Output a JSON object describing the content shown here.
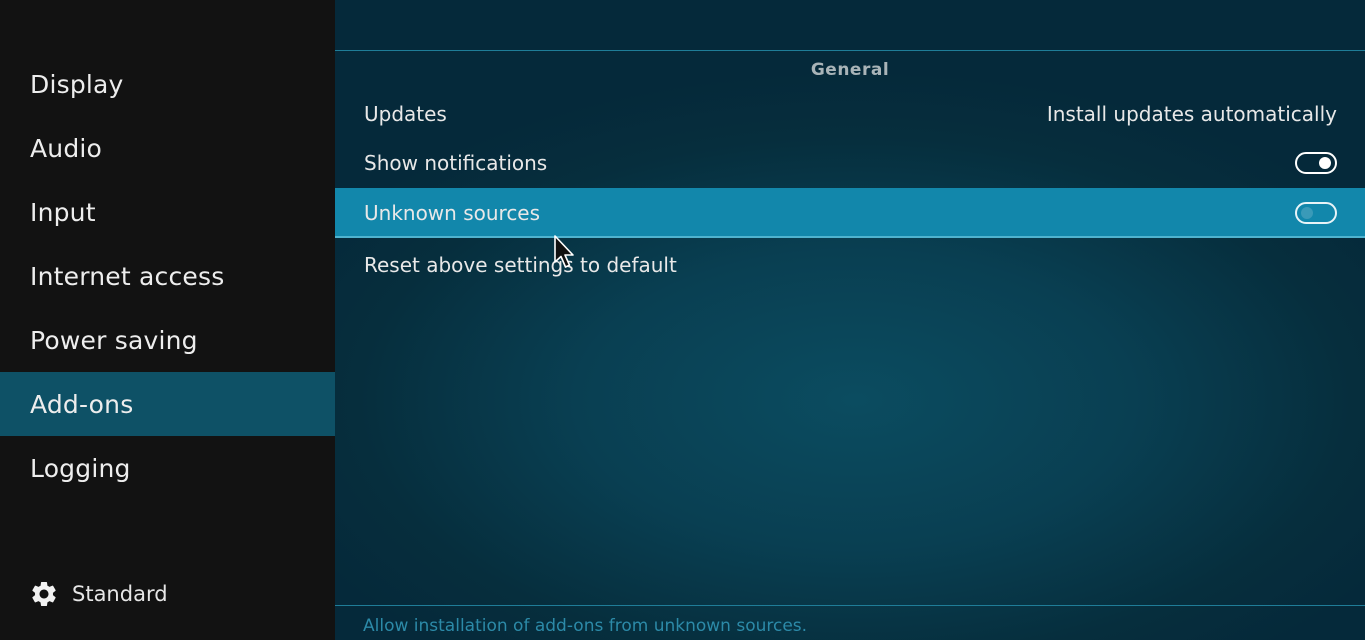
{
  "sidebar": {
    "items": [
      {
        "label": "Display"
      },
      {
        "label": "Audio"
      },
      {
        "label": "Input"
      },
      {
        "label": "Internet access"
      },
      {
        "label": "Power saving"
      },
      {
        "label": "Add-ons",
        "active": true
      },
      {
        "label": "Logging"
      }
    ],
    "level": {
      "icon": "gear-icon",
      "label": "Standard"
    }
  },
  "main": {
    "group_title": "General",
    "settings": [
      {
        "label": "Updates",
        "value": "Install updates automatically"
      },
      {
        "label": "Show notifications",
        "toggle": "on"
      },
      {
        "label": "Unknown sources",
        "toggle": "off",
        "focused": true
      },
      {
        "label": "Reset above settings to default"
      }
    ],
    "help_text": "Allow installation of add-ons from unknown sources."
  },
  "colors": {
    "sidebar_bg": "#121212",
    "active_nav_bg": "#0e5166",
    "focused_row_bg": "#1287ab",
    "main_bg": "#093f52"
  }
}
